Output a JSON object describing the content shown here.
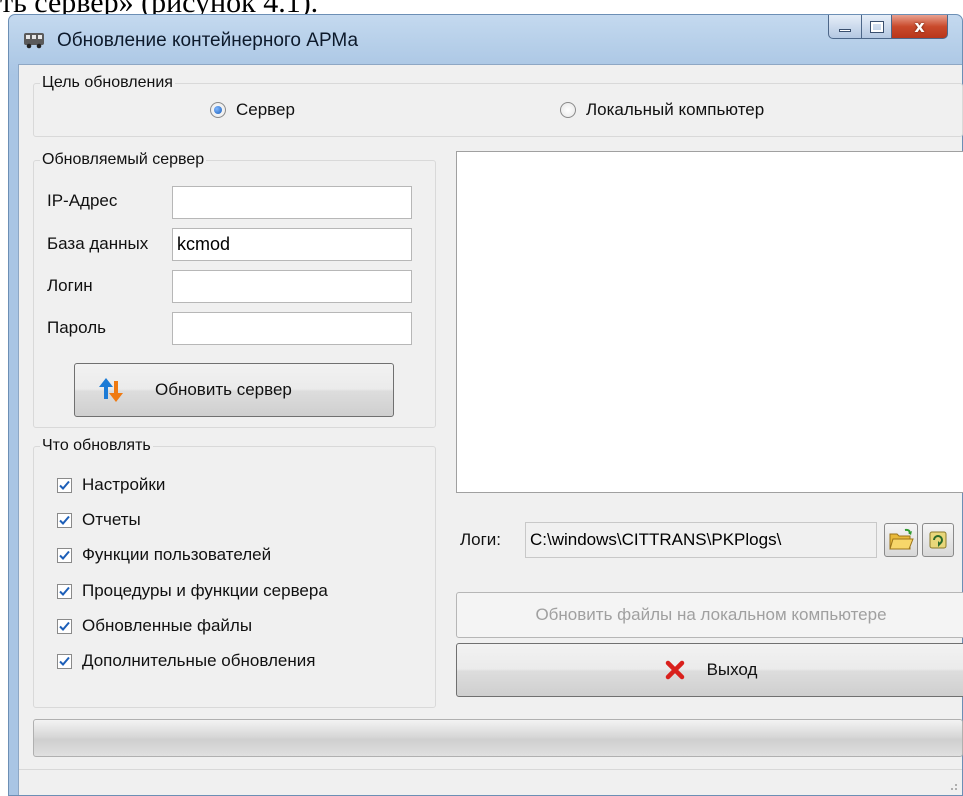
{
  "document": {
    "text_above": "ть сервер» (рисунок 4.1)."
  },
  "window": {
    "title": "Обновление контейнерного АРМа",
    "controls": {
      "close_symbol": "x"
    }
  },
  "target_group": {
    "label": "Цель обновления",
    "options": [
      {
        "label": "Сервер",
        "selected": true
      },
      {
        "label": "Локальный компьютер",
        "selected": false
      }
    ]
  },
  "server_group": {
    "label": "Обновляемый сервер",
    "fields": {
      "ip": {
        "label": "IP-Адрес",
        "value": ""
      },
      "db": {
        "label": "База данных",
        "value": "kcmod"
      },
      "login": {
        "label": "Логин",
        "value": ""
      },
      "password": {
        "label": "Пароль",
        "value": ""
      }
    },
    "update_button": {
      "label": "Обновить сервер",
      "icon": "refresh-arrows-icon"
    }
  },
  "what_group": {
    "label": "Что обновлять",
    "items": [
      {
        "label": "Настройки",
        "checked": true
      },
      {
        "label": "Отчеты",
        "checked": true
      },
      {
        "label": "Функции пользователей",
        "checked": true
      },
      {
        "label": "Процедуры и функции сервера",
        "checked": true
      },
      {
        "label": "Обновленные файлы",
        "checked": true
      },
      {
        "label": "Дополнительные обновления",
        "checked": true
      }
    ]
  },
  "logs": {
    "label": "Логи:",
    "path": "C:\\windows\\CITTRANS\\PKPlogs\\",
    "open_folder_icon": "open-folder-icon",
    "refresh_icon": "refresh-icon"
  },
  "update_local_button": {
    "label": "Обновить файлы на локальном компьютере",
    "enabled": false
  },
  "exit_button": {
    "label": "Выход",
    "icon": "red-x-icon"
  },
  "colors": {
    "accent": "#1d5fb8",
    "exit_icon": "#d9201c",
    "window_frame": "#b6cfe9"
  }
}
